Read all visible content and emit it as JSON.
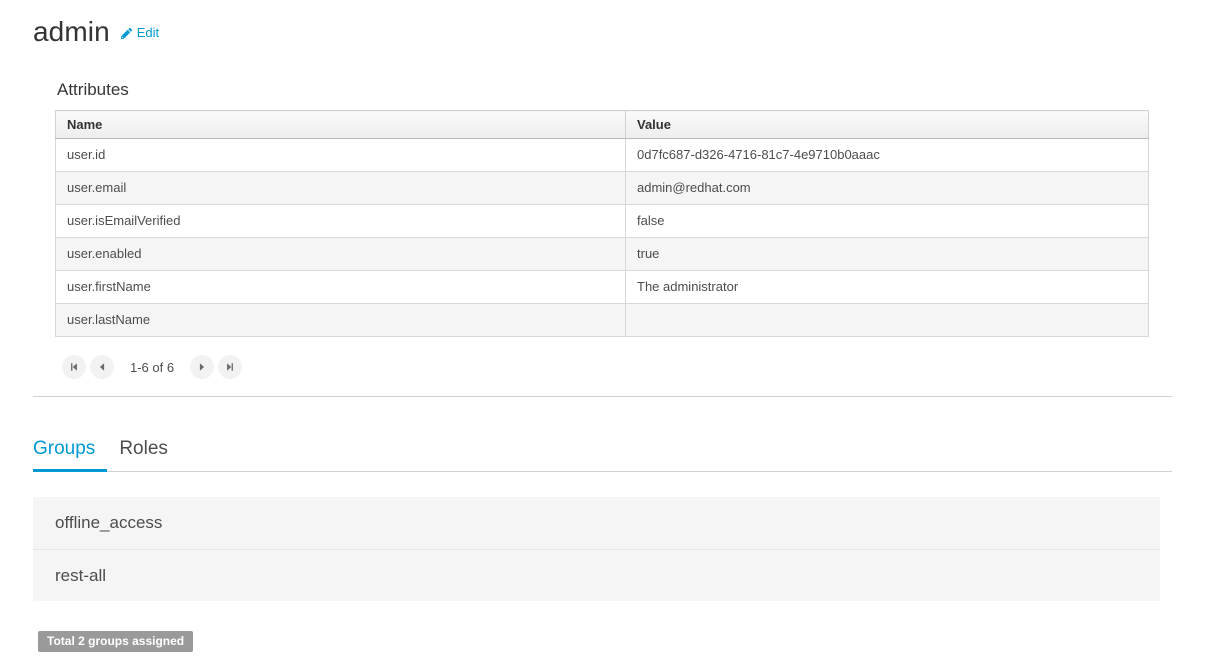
{
  "header": {
    "title": "admin",
    "edit_label": "Edit",
    "edit_icon": "pencil-icon",
    "accent_color": "#0099d3"
  },
  "attributes_section": {
    "title": "Attributes",
    "columns": [
      "Name",
      "Value"
    ],
    "rows": [
      {
        "name": "user.id",
        "value": "0d7fc687-d326-4716-81c7-4e9710b0aaac"
      },
      {
        "name": "user.email",
        "value": "admin@redhat.com"
      },
      {
        "name": "user.isEmailVerified",
        "value": "false"
      },
      {
        "name": "user.enabled",
        "value": "true"
      },
      {
        "name": "user.firstName",
        "value": "The administrator"
      },
      {
        "name": "user.lastName",
        "value": ""
      }
    ],
    "pagination": {
      "range_label": "1-6 of 6",
      "first_icon": "first-page-icon",
      "prev_icon": "previous-page-icon",
      "next_icon": "next-page-icon",
      "last_icon": "last-page-icon"
    }
  },
  "tabs": [
    {
      "label": "Groups",
      "active": true
    },
    {
      "label": "Roles",
      "active": false
    }
  ],
  "groups": {
    "items": [
      {
        "label": "offline_access"
      },
      {
        "label": "rest-all"
      }
    ],
    "total_badge": "Total 2 groups assigned",
    "badge_color": "#9a9a9a"
  }
}
